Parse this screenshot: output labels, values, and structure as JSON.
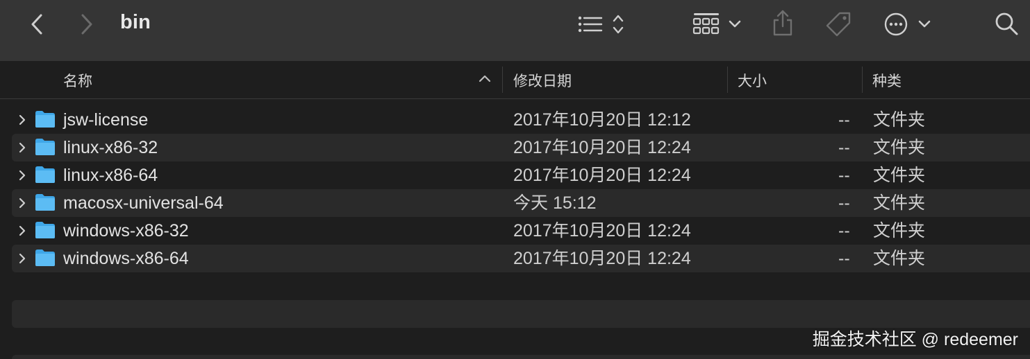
{
  "window": {
    "title": "bin"
  },
  "toolbar": {
    "back_icon": "chevron-left-icon",
    "forward_icon": "chevron-right-icon",
    "view_icon": "list-view-icon",
    "group_icon": "group-grid-icon",
    "share_icon": "share-icon",
    "tag_icon": "tag-icon",
    "more_icon": "ellipsis-circle-icon",
    "search_icon": "search-icon"
  },
  "columns": {
    "name": "名称",
    "date": "修改日期",
    "size": "大小",
    "kind": "种类"
  },
  "files": [
    {
      "name": "jsw-license",
      "date": "2017年10月20日 12:12",
      "size": "--",
      "kind": "文件夹"
    },
    {
      "name": "linux-x86-32",
      "date": "2017年10月20日 12:24",
      "size": "--",
      "kind": "文件夹"
    },
    {
      "name": "linux-x86-64",
      "date": "2017年10月20日 12:24",
      "size": "--",
      "kind": "文件夹"
    },
    {
      "name": "macosx-universal-64",
      "date": "今天 15:12",
      "size": "--",
      "kind": "文件夹"
    },
    {
      "name": "windows-x86-32",
      "date": "2017年10月20日 12:24",
      "size": "--",
      "kind": "文件夹"
    },
    {
      "name": "windows-x86-64",
      "date": "2017年10月20日 12:24",
      "size": "--",
      "kind": "文件夹"
    }
  ],
  "watermark": "掘金技术社区 @ redeemer",
  "colors": {
    "toolbar_bg": "#353535",
    "window_bg": "#1e1e1e",
    "alt_row_bg": "#2a2a2a",
    "folder_blue": "#3fa7e8"
  }
}
